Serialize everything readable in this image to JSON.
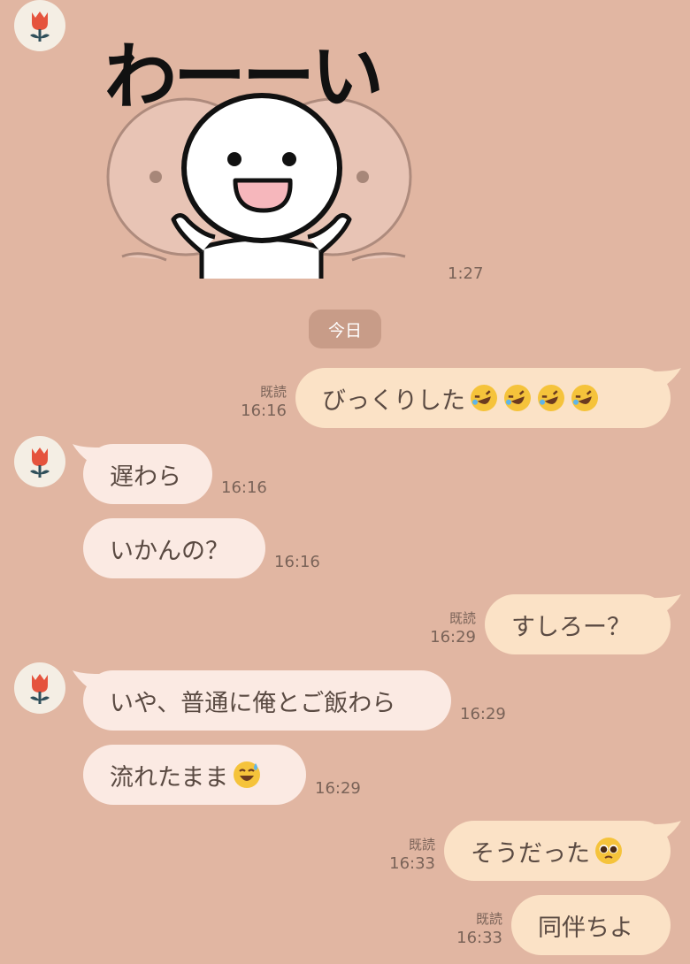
{
  "chat": {
    "sticker": {
      "text": "わーーい",
      "time": "1:27"
    },
    "date_divider": "今日",
    "messages": [
      {
        "side": "out",
        "text": "びっくりした",
        "emoji": [
          "rolling-laughing",
          "rolling-laughing",
          "rolling-laughing",
          "rolling-laughing"
        ],
        "read": "既読",
        "time": "16:16"
      },
      {
        "side": "in",
        "text": "遅わら",
        "time": "16:16"
      },
      {
        "side": "in",
        "text": "いかんの？",
        "time": "16:16"
      },
      {
        "side": "out",
        "text": "すしろー？",
        "read": "既読",
        "time": "16:29"
      },
      {
        "side": "in",
        "text": "いや、普通に俺とご飯わら",
        "time": "16:29"
      },
      {
        "side": "in",
        "text": "流れたまま",
        "emoji": [
          "sweat-smile"
        ],
        "time": "16:29"
      },
      {
        "side": "out",
        "text": "そうだった",
        "emoji": [
          "pleading-face"
        ],
        "read": "既読",
        "time": "16:33"
      },
      {
        "side": "out",
        "text": "同伴ちよ",
        "read": "既読",
        "time": "16:33"
      }
    ]
  },
  "colors": {
    "background": "#e1b6a2",
    "incoming_bubble": "#fbeae3",
    "outgoing_bubble": "#fbe2c6",
    "date_pill": "#c89c88",
    "avatar_bg": "#f4eee4"
  },
  "icons": {
    "avatar": "red-tulip-icon"
  }
}
